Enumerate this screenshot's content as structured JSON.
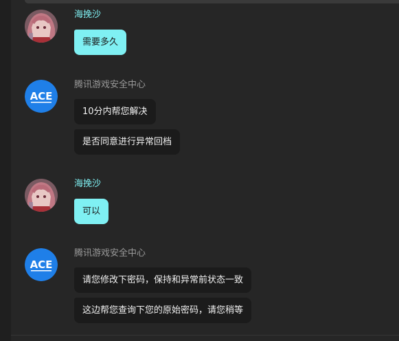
{
  "colors": {
    "background": "#262626",
    "self_bubble": "#7ff0f3",
    "other_bubble": "#1b1b1b",
    "self_name": "#7ff0f3",
    "other_name": "#9a9a9a",
    "ace_avatar": "#1f7fe8"
  },
  "messages": [
    {
      "sender": "海挽沙",
      "avatar_icon": "anime-girl-avatar-icon",
      "texts": [
        "需要多久"
      ]
    },
    {
      "sender": "腾讯游戏安全中心",
      "avatar_icon": "ace-logo-icon",
      "avatar_text": "ACE",
      "texts": [
        "10分内帮您解决",
        "是否同意进行异常回档"
      ]
    },
    {
      "sender": "海挽沙",
      "avatar_icon": "anime-girl-avatar-icon",
      "texts": [
        "可以"
      ]
    },
    {
      "sender": "腾讯游戏安全中心",
      "avatar_icon": "ace-logo-icon",
      "avatar_text": "ACE",
      "texts": [
        "请您修改下密码，保持和异常前状态一致",
        "这边帮您查询下您的原始密码，请您稍等"
      ]
    }
  ]
}
